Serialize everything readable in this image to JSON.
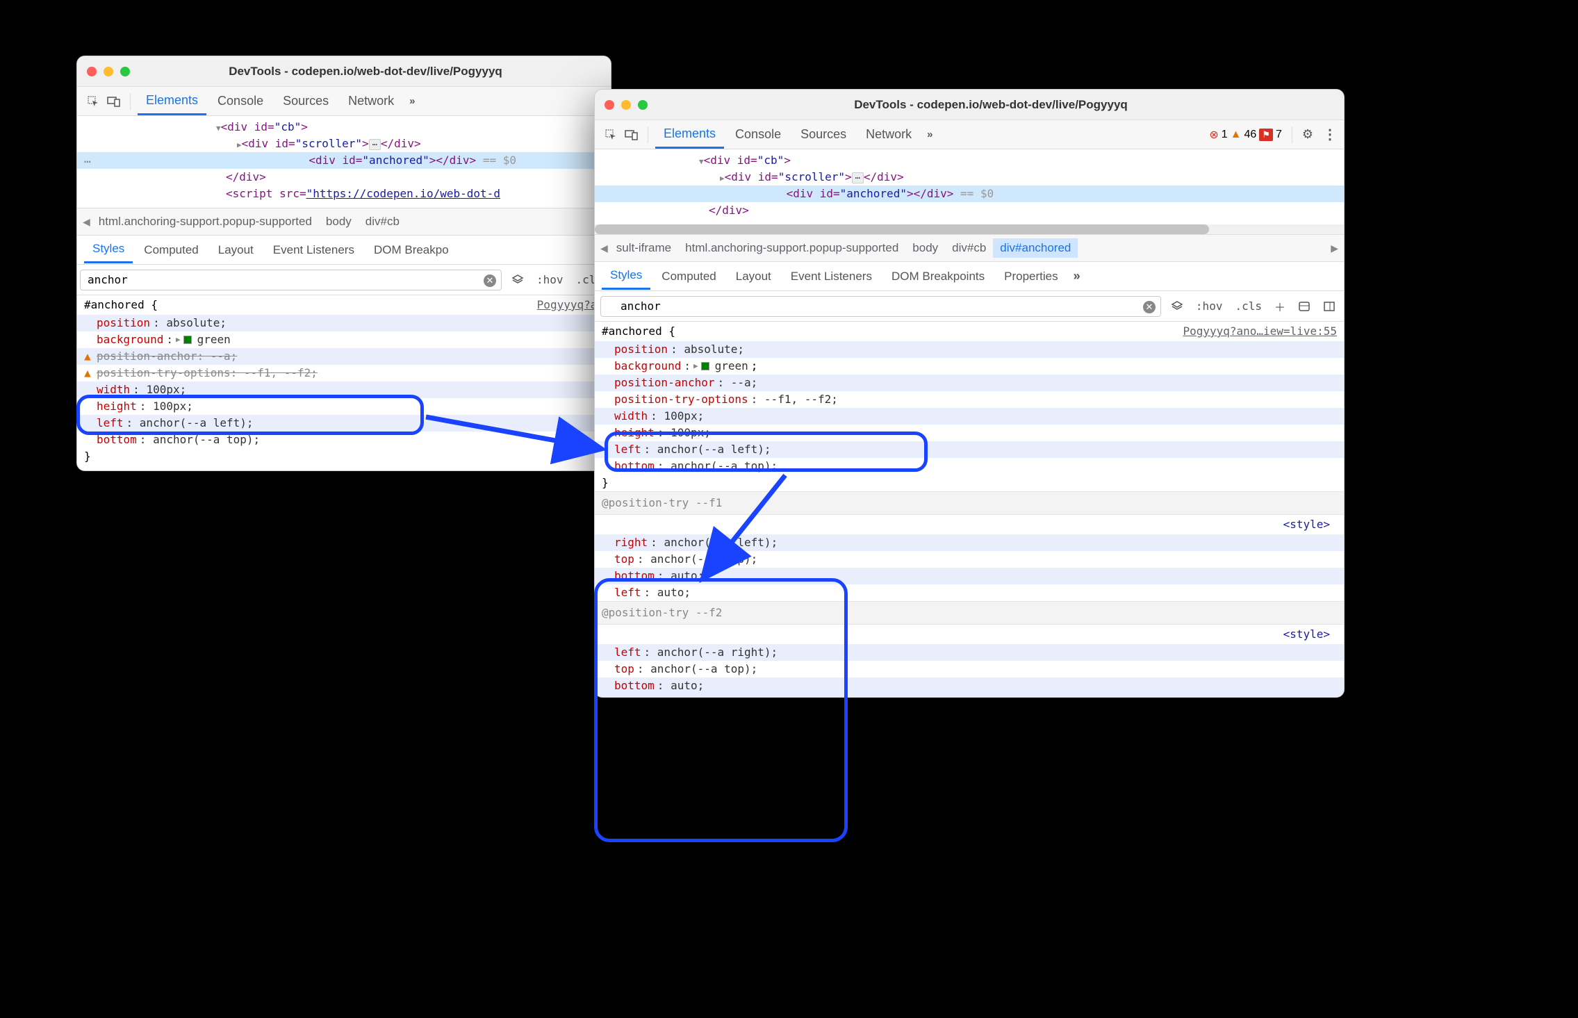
{
  "win1": {
    "title": "DevTools - codepen.io/web-dot-dev/live/Pogyyyq",
    "tabs": {
      "elements": "Elements",
      "console": "Console",
      "sources": "Sources",
      "network": "Network"
    },
    "dom": {
      "l1a": "<div id=",
      "l1b": "\"cb\"",
      "l1c": ">",
      "l2a": "<div id=",
      "l2b": "\"scroller\"",
      "l2c": ">",
      "l2d": "</div>",
      "l3a": "<div id=",
      "l3b": "\"anchored\"",
      "l3c": ">",
      "l3d": "</div>",
      "l3e": " == $0",
      "l4": "</div>",
      "l5a": "<script src=",
      "l5b": "\"https://codepen.io/web-dot-d"
    },
    "crumbs": {
      "c1": "html.anchoring-support.popup-supported",
      "c2": "body",
      "c3": "div#cb"
    },
    "subtabs": {
      "styles": "Styles",
      "computed": "Computed",
      "layout": "Layout",
      "listeners": "Event Listeners",
      "dom": "DOM Breakpo"
    },
    "filter": "anchor",
    "hov": ":hov",
    "cls": ".cls",
    "rule_source": "Pogyyyq?an",
    "rules": {
      "selector": "#anchored {",
      "position": "position",
      "position_v": ": absolute;",
      "background": "background",
      "background_v": ": ",
      "green": "green",
      "pos_anchor": "position-anchor",
      "pos_anchor_v": ": --a;",
      "pos_try": "position-try-options",
      "pos_try_v": ": --f1, --f2;",
      "width": "width",
      "width_v": ": 100px;",
      "height": "height",
      "height_v": ": 100px;",
      "left": "left",
      "left_v": ": anchor(--a left);",
      "bottom": "bottom",
      "bottom_v": ": anchor(--a top);",
      "close": "}"
    }
  },
  "win2": {
    "title": "DevTools - codepen.io/web-dot-dev/live/Pogyyyq",
    "tabs": {
      "elements": "Elements",
      "console": "Console",
      "sources": "Sources",
      "network": "Network"
    },
    "badges": {
      "err": "1",
      "warn": "46",
      "info": "7"
    },
    "dom": {
      "l1a": "<div id=",
      "l1b": "\"cb\"",
      "l1c": ">",
      "l2a": "<div id=",
      "l2b": "\"scroller\"",
      "l2c": ">",
      "l2d": "</div>",
      "l3a": "<div id=",
      "l3b": "\"anchored\"",
      "l3c": ">",
      "l3d": "</div>",
      "l3e": " == $0",
      "l4": "</div>"
    },
    "crumbs": {
      "c0": "sult-iframe",
      "c1": "html.anchoring-support.popup-supported",
      "c2": "body",
      "c3": "div#cb",
      "c4": "div#anchored"
    },
    "subtabs": {
      "styles": "Styles",
      "computed": "Computed",
      "layout": "Layout",
      "listeners": "Event Listeners",
      "dom": "DOM Breakpoints",
      "props": "Properties"
    },
    "filter": "anchor",
    "hov": ":hov",
    "cls": ".cls",
    "rule_source": "Pogyyyq?ano…iew=live:55",
    "rules": {
      "selector": "#anchored {",
      "position": "position",
      "position_v": ": absolute;",
      "background": "background",
      "background_v": ": ",
      "green": "green",
      "pos_anchor": "position-anchor",
      "pos_anchor_v": ": --a;",
      "pos_try": "position-try-options",
      "pos_try_v": ": --f1, --f2;",
      "width": "width",
      "width_v": ": 100px;",
      "height": "height",
      "height_v": ": 100px;",
      "left": "left",
      "left_v": ": anchor(--a left);",
      "bottom": "bottom",
      "bottom_v": ": anchor(--a top);",
      "close": "}"
    },
    "pt1": {
      "head": "@position-try --f1",
      "right": "right",
      "right_v": ": anchor(--a left);",
      "top": "top",
      "top_v": ": anchor(--a top);",
      "bottom": "bottom",
      "bottom_v": ": auto;",
      "left": "left",
      "left_v": ": auto;"
    },
    "pt2": {
      "head": "@position-try --f2",
      "left": "left",
      "left_v": ": anchor(--a right);",
      "top": "top",
      "top_v": ": anchor(--a top);",
      "bottom": "bottom",
      "bottom_v": ": auto;"
    },
    "style_link": "<style>"
  }
}
